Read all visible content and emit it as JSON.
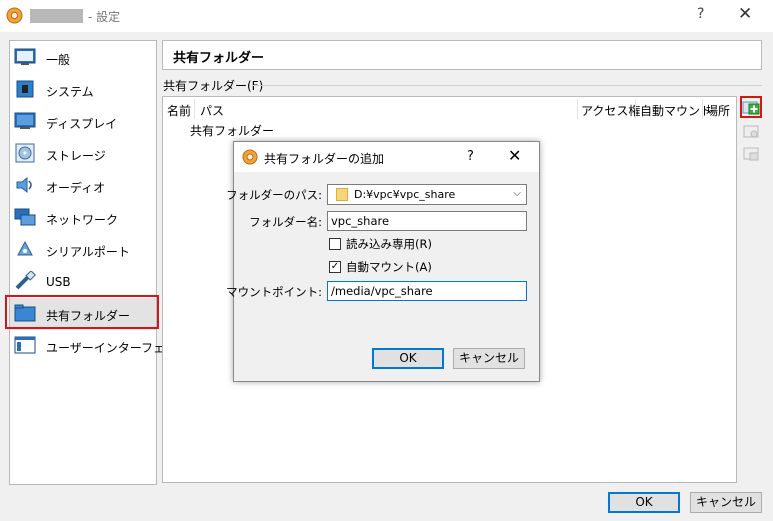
{
  "window": {
    "title": "- 設定",
    "help": "?",
    "close": "✕"
  },
  "sidebar": {
    "items": [
      {
        "label": "一般"
      },
      {
        "label": "システム"
      },
      {
        "label": "ディスプレイ"
      },
      {
        "label": "ストレージ"
      },
      {
        "label": "オーディオ"
      },
      {
        "label": "ネットワーク"
      },
      {
        "label": "シリアルポート"
      },
      {
        "label": "USB"
      },
      {
        "label": "共有フォルダー"
      },
      {
        "label": "ユーザーインターフェース"
      }
    ],
    "selected_index": 8
  },
  "main": {
    "title": "共有フォルダー",
    "group_label": "共有フォルダー(F)",
    "columns": {
      "name": "名前",
      "path": "パス",
      "access": "アクセス権",
      "automount": "自動マウント",
      "location": "場所"
    },
    "rows": [
      "共有フォルダー"
    ],
    "ok": "OK",
    "cancel": "キャンセル"
  },
  "dialog": {
    "title": "共有フォルダーの追加",
    "help": "?",
    "close": "✕",
    "path_label": "フォルダーのパス:",
    "path_value": "D:¥vpc¥vpc_share",
    "name_label": "フォルダー名:",
    "name_value": "vpc_share",
    "readonly_label": "読み込み専用(R)",
    "readonly_checked": false,
    "automount_label": "自動マウント(A)",
    "automount_checked": true,
    "mountpoint_label": "マウントポイント:",
    "mountpoint_value": "/media/vpc_share",
    "ok": "OK",
    "cancel": "キャンセル"
  },
  "colors": {
    "accent": "#0078d7",
    "highlight": "#d01818"
  }
}
